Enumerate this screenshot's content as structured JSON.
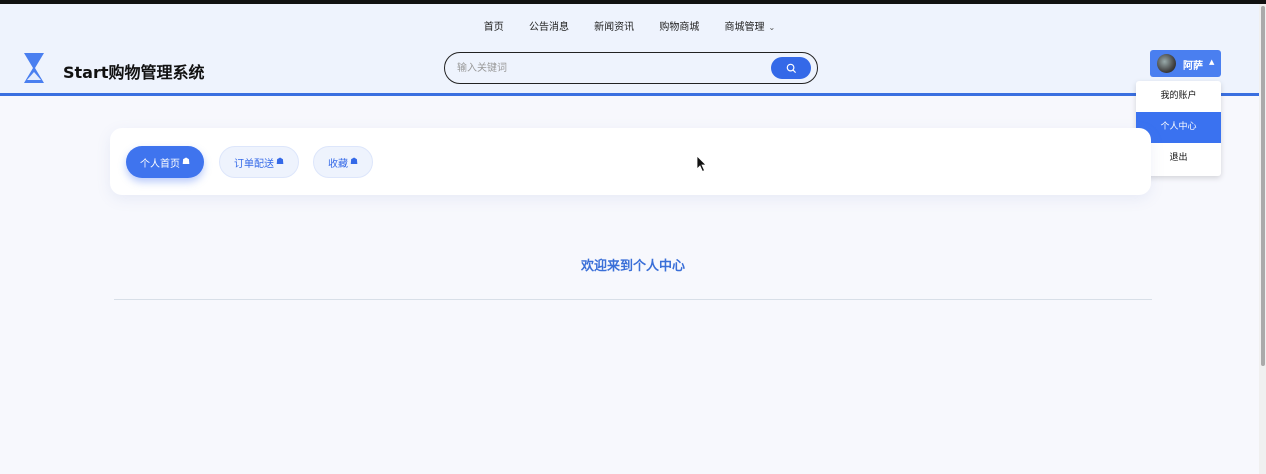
{
  "nav": {
    "items": [
      "首页",
      "公告消息",
      "新闻资讯",
      "购物商城",
      "商城管理"
    ],
    "caret": "⌄"
  },
  "brand": {
    "title": "Start购物管理系统"
  },
  "search": {
    "placeholder": "输入关键词",
    "icon": "search-icon"
  },
  "user": {
    "name": "阿萨",
    "caret": "▲",
    "menu": [
      "我的账户",
      "个人中心",
      "退出"
    ],
    "active_menu": "个人中心"
  },
  "tabs": {
    "items": [
      {
        "label": "个人首页",
        "icon": "☗"
      },
      {
        "label": "订单配送",
        "icon": "☗"
      },
      {
        "label": "收藏",
        "icon": "☗"
      }
    ],
    "active": "个人首页"
  },
  "main": {
    "welcome": "欢迎来到个人中心"
  },
  "colors": {
    "accent": "#3469e8",
    "header_bg": "#eef3fd",
    "welcome": "#3a6fd8"
  }
}
